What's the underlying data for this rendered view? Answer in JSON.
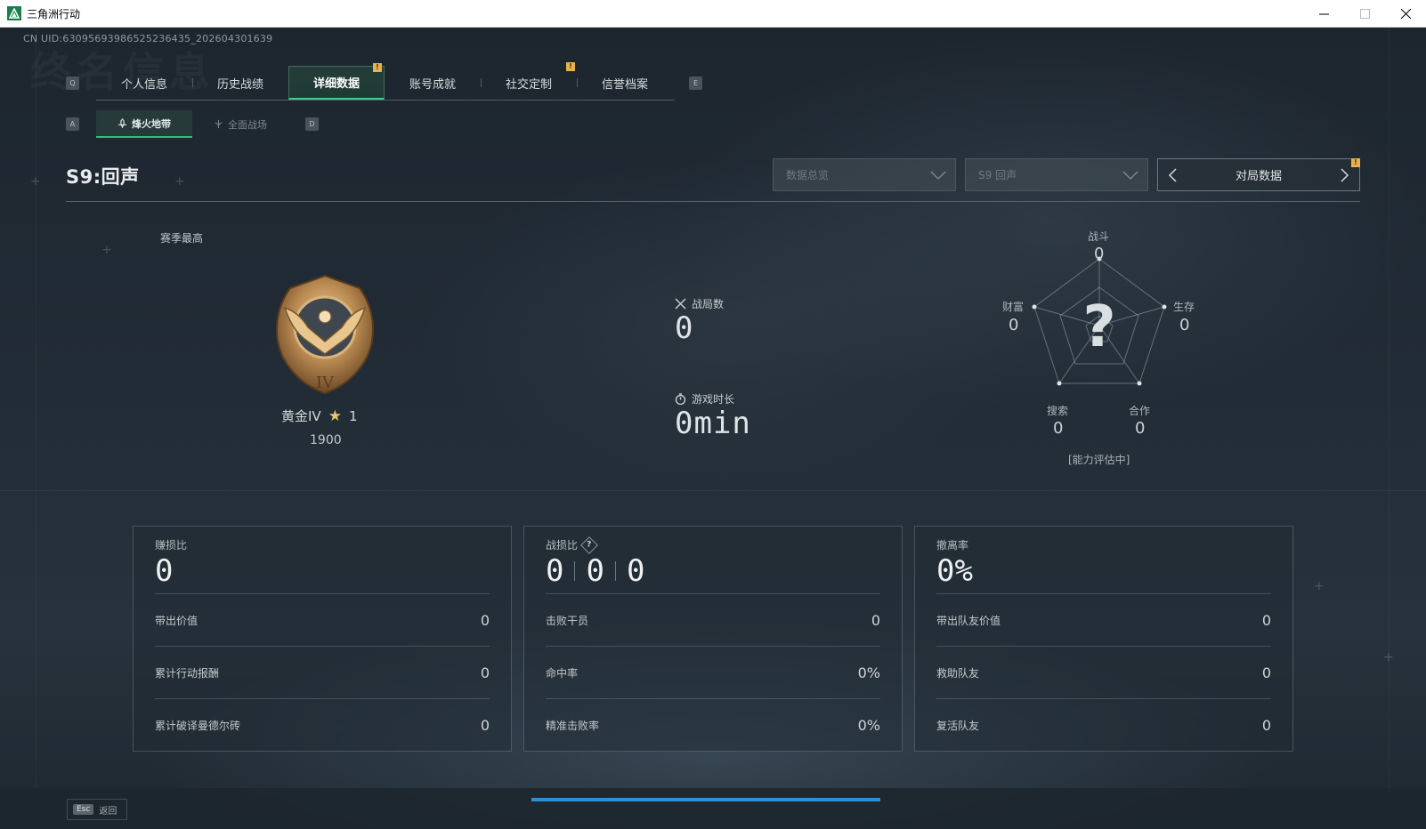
{
  "window": {
    "title": "三角洲行动"
  },
  "header": {
    "uid": "CN UID:63095693986525236435_202604301639",
    "watermark": "终名信息"
  },
  "main_tabs": {
    "key_left": "Q",
    "key_right": "E",
    "items": [
      {
        "label": "个人信息",
        "active": false,
        "badge": false
      },
      {
        "label": "历史战绩",
        "active": false,
        "badge": false
      },
      {
        "label": "详细数据",
        "active": true,
        "badge": true
      },
      {
        "label": "账号成就",
        "active": false,
        "badge": false
      },
      {
        "label": "社交定制",
        "active": false,
        "badge": true
      },
      {
        "label": "信誉档案",
        "active": false,
        "badge": false
      }
    ],
    "badge_text": "!"
  },
  "sub_tabs": {
    "key_left": "A",
    "key_right": "D",
    "items": [
      {
        "label": "烽火地带",
        "icon": "extraction-icon",
        "active": true
      },
      {
        "label": "全面战场",
        "icon": "battlefield-icon",
        "active": false
      }
    ]
  },
  "section": {
    "title": "S9:回声"
  },
  "filters": {
    "data_overview": "数据总览",
    "season": "S9 回声",
    "pager_label": "对局数据"
  },
  "rank": {
    "season_best_label": "赛季最高",
    "tier": "黄金IV",
    "stars": "1",
    "score": "1900",
    "medal_numeral": "IV"
  },
  "middle": {
    "matches_label": "战局数",
    "matches_value": "0",
    "playtime_label": "游戏时长",
    "playtime_value": "0min"
  },
  "radar": {
    "combat_label": "战斗",
    "combat_value": "0",
    "survival_label": "生存",
    "survival_value": "0",
    "wealth_label": "财富",
    "wealth_value": "0",
    "search_label": "搜索",
    "search_value": "0",
    "coop_label": "合作",
    "coop_value": "0",
    "center_mark": "?",
    "note": "[能力评估中]"
  },
  "cards": {
    "profit": {
      "title": "赚损比",
      "big": "0",
      "rows": [
        {
          "label": "带出价值",
          "value": "0"
        },
        {
          "label": "累计行动报酬",
          "value": "0"
        },
        {
          "label": "累计破译曼德尔砖",
          "value": "0"
        }
      ]
    },
    "kd": {
      "title": "战损比",
      "help": "?",
      "big": [
        "0",
        "0",
        "0"
      ],
      "rows": [
        {
          "label": "击败干员",
          "value": "0"
        },
        {
          "label": "命中率",
          "value": "0%"
        },
        {
          "label": "精准击败率",
          "value": "0%"
        }
      ]
    },
    "extract": {
      "title": "撤离率",
      "big": "0%",
      "rows": [
        {
          "label": "带出队友价值",
          "value": "0"
        },
        {
          "label": "救助队友",
          "value": "0"
        },
        {
          "label": "复活队友",
          "value": "0"
        }
      ]
    }
  },
  "footer": {
    "esc_key": "Esc",
    "esc_label": "返回"
  },
  "colors": {
    "accent_green": "#36d18a",
    "badge_yellow": "#e6b34a",
    "progress_blue": "#2e8fd6",
    "star_gold": "#e8c566"
  }
}
